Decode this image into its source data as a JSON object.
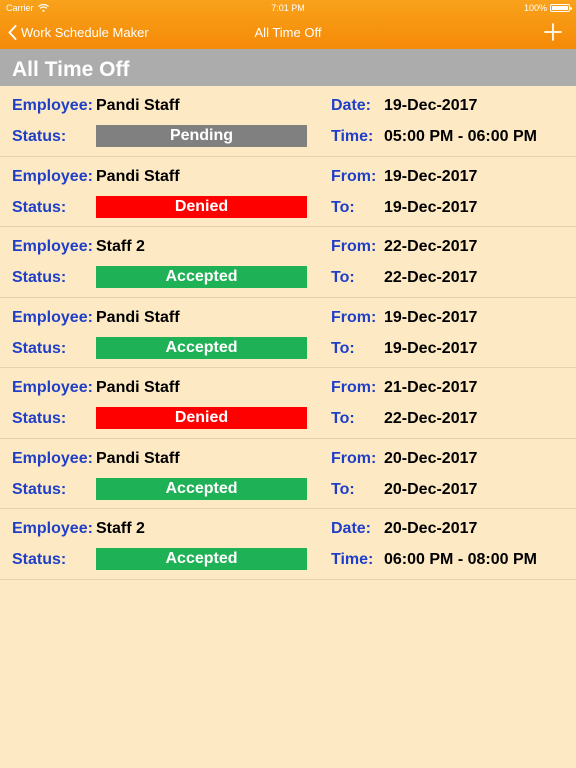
{
  "status_bar": {
    "carrier": "Carrier",
    "time": "7:01 PM",
    "battery": "100%"
  },
  "nav": {
    "back_label": "Work Schedule Maker",
    "title": "All Time Off"
  },
  "section": {
    "title": "All Time Off"
  },
  "labels": {
    "employee": "Employee:",
    "status": "Status:",
    "date": "Date:",
    "time": "Time:",
    "from": "From:",
    "to": "To:"
  },
  "colors": {
    "pending": "#808080",
    "denied": "#ff0000",
    "accepted": "#1fb155",
    "nav": "#f7950f",
    "label": "#1f3fc8",
    "background": "#fdeac4"
  },
  "entries": [
    {
      "employee": "Pandi Staff",
      "status": "Pending",
      "type": "single",
      "date": "19-Dec-2017",
      "time": "05:00 PM - 06:00 PM"
    },
    {
      "employee": "Pandi Staff",
      "status": "Denied",
      "type": "range",
      "from": "19-Dec-2017",
      "to": "19-Dec-2017"
    },
    {
      "employee": "Staff 2",
      "status": "Accepted",
      "type": "range",
      "from": "22-Dec-2017",
      "to": "22-Dec-2017"
    },
    {
      "employee": "Pandi Staff",
      "status": "Accepted",
      "type": "range",
      "from": "19-Dec-2017",
      "to": "19-Dec-2017"
    },
    {
      "employee": "Pandi Staff",
      "status": "Denied",
      "type": "range",
      "from": "21-Dec-2017",
      "to": "22-Dec-2017"
    },
    {
      "employee": "Pandi Staff",
      "status": "Accepted",
      "type": "range",
      "from": "20-Dec-2017",
      "to": "20-Dec-2017"
    },
    {
      "employee": "Staff 2",
      "status": "Accepted",
      "type": "single",
      "date": "20-Dec-2017",
      "time": "06:00 PM - 08:00 PM"
    }
  ]
}
